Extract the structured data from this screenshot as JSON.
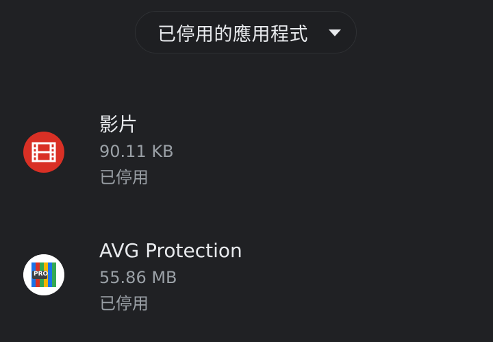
{
  "filter": {
    "label": "已停用的應用程式",
    "icon": "arrow-drop-down-icon"
  },
  "apps": [
    {
      "name": "影片",
      "size": "90.11 KB",
      "status": "已停用",
      "icon": "video-film-icon",
      "icon_color": "#d93025"
    },
    {
      "name": "AVG Protection",
      "size": "55.86 MB",
      "status": "已停用",
      "icon": "avg-pro-icon",
      "icon_badge": "PRO"
    }
  ],
  "colors": {
    "background": "#202124",
    "primary_text": "#e8eaed",
    "secondary_text": "#9aa0a6"
  }
}
